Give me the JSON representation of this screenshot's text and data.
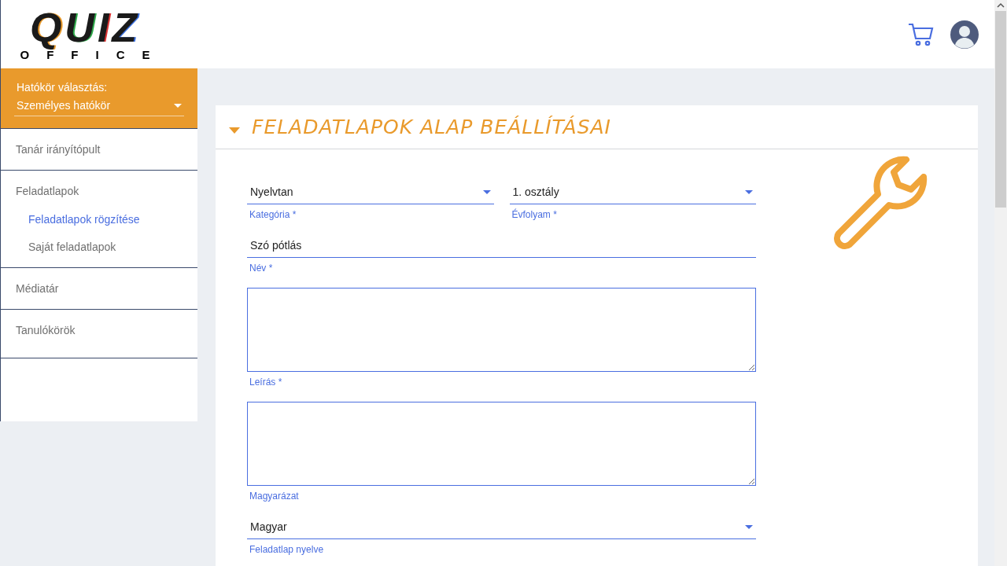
{
  "logo": {
    "word": "QUIZ",
    "subtitle": "OFFICE"
  },
  "scope": {
    "label": "Hatókör választás:",
    "value": "Személyes hatókör"
  },
  "sidebar": {
    "items": [
      {
        "label": "Tanár irányítópult",
        "selected": false
      },
      {
        "label": "Feladatlapok",
        "selected": false,
        "children": [
          {
            "label": "Feladatlapok rögzítése",
            "selected": true
          },
          {
            "label": "Saját feladatlapok",
            "selected": false
          }
        ]
      },
      {
        "label": "Médiatár",
        "selected": false
      },
      {
        "label": "Tanulókörök",
        "selected": false
      }
    ]
  },
  "section": {
    "title": "FELADATLAPOK ALAP BEÁLLÍTÁSAI",
    "expanded": true
  },
  "form": {
    "rows": [
      [
        {
          "kind": "select",
          "value": "Nyelvtan",
          "label": "Kategória *"
        },
        {
          "kind": "select",
          "value": "1. osztály",
          "label": "Évfolyam *"
        }
      ],
      [
        {
          "kind": "text",
          "value": "Szó pótlás",
          "label": "Név *"
        }
      ],
      [
        {
          "kind": "textarea",
          "label": "Leírás *"
        }
      ],
      [
        {
          "kind": "textarea",
          "label": "Magyarázat"
        }
      ],
      [
        {
          "kind": "select",
          "value": "Magyar",
          "label": "Feladatlap nyelve"
        }
      ]
    ]
  }
}
